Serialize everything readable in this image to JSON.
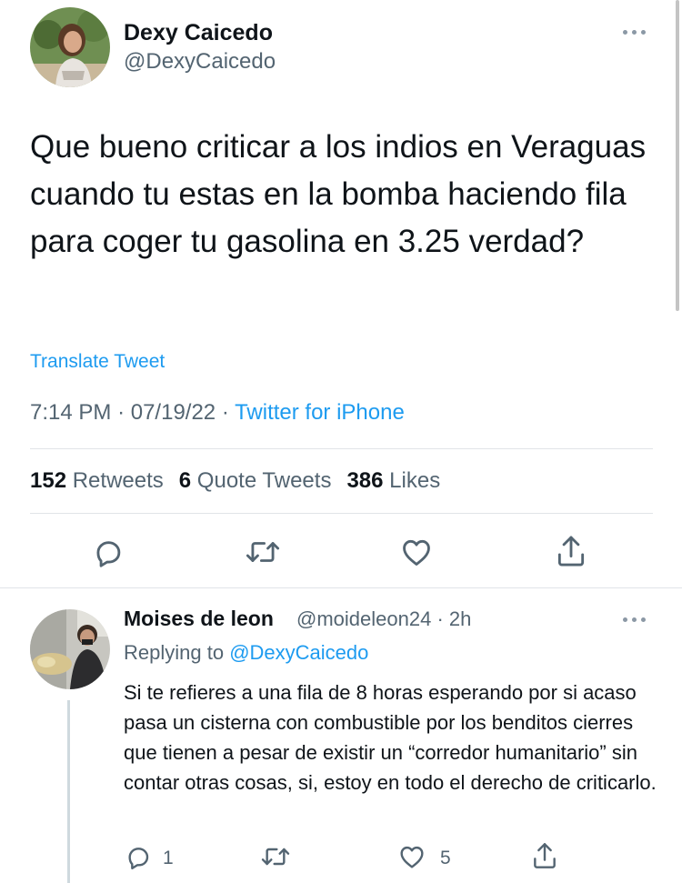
{
  "tweet": {
    "author": {
      "name": "Dexy Caicedo",
      "handle": "@DexyCaicedo"
    },
    "text": "Que bueno criticar a los indios en Veraguas cuando tu estas en la bomba haciendo fila para coger tu gasolina en 3.25 verdad?",
    "translate_label": "Translate Tweet",
    "time": "7:14 PM",
    "separator": "·",
    "date": "07/19/22",
    "source": "Twitter for iPhone",
    "stats": [
      {
        "count": "152",
        "label": "Retweets"
      },
      {
        "count": "6",
        "label": "Quote Tweets"
      },
      {
        "count": "386",
        "label": "Likes"
      }
    ],
    "actions": [
      "reply-icon",
      "retweet-icon",
      "like-icon",
      "share-icon"
    ]
  },
  "reply": {
    "author": {
      "name": "Moises de leon",
      "handle": "@moideleon24",
      "age": "· 2h"
    },
    "replying_prefix": "Replying to",
    "replying_to": "@DexyCaicedo",
    "text": "Si te refieres a una fila de 8 horas esperando por si acaso pasa un cisterna con combustible por los benditos cierres que tienen a pesar de existir un “corredor humanitario” sin contar otras cosas, si, estoy en todo el derecho de criticarlo.",
    "reply_count": "1",
    "like_count": "5"
  },
  "colors": {
    "link": "#1d9bf0",
    "secondary": "#536471",
    "primary": "#0f1419",
    "divider": "#e1e4e8"
  }
}
